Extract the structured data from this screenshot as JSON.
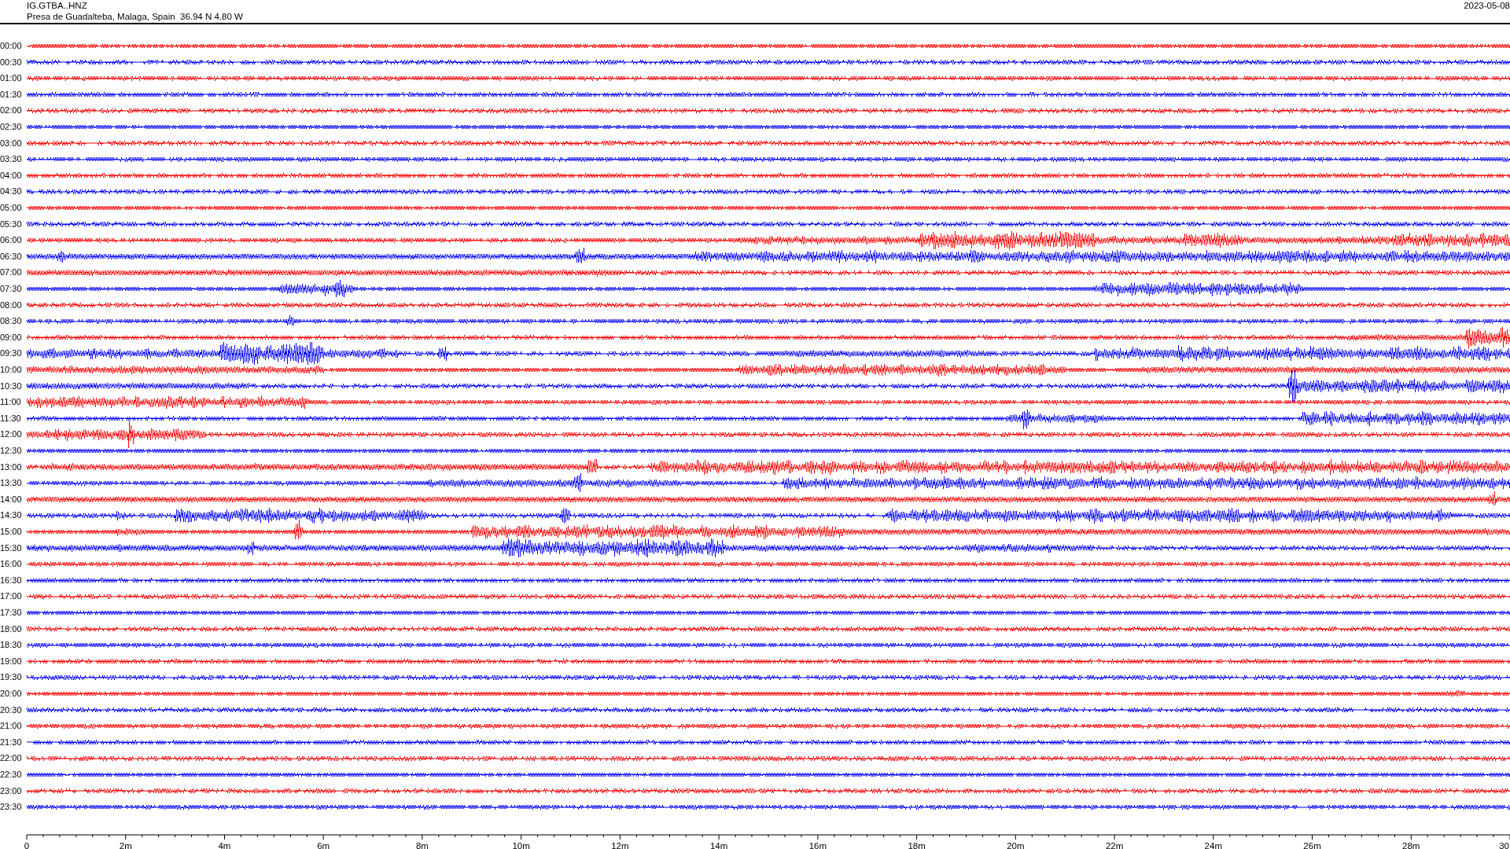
{
  "header": {
    "station": "IG.GTBA..HNZ",
    "location": "Presa de Guadalteba, Malaga, Spain  36.94 N 4.80 W",
    "date": "2023-05-08"
  },
  "rows": [
    {
      "label": "00:00",
      "color": "#ff0000"
    },
    {
      "label": "00:30",
      "color": "#0000ff"
    },
    {
      "label": "01:00",
      "color": "#ff0000"
    },
    {
      "label": "01:30",
      "color": "#0000ff"
    },
    {
      "label": "02:00",
      "color": "#ff0000"
    },
    {
      "label": "02:30",
      "color": "#0000ff"
    },
    {
      "label": "03:00",
      "color": "#ff0000"
    },
    {
      "label": "03:30",
      "color": "#0000ff"
    },
    {
      "label": "04:00",
      "color": "#ff0000"
    },
    {
      "label": "04:30",
      "color": "#0000ff"
    },
    {
      "label": "05:00",
      "color": "#ff0000"
    },
    {
      "label": "05:30",
      "color": "#0000ff"
    },
    {
      "label": "06:00",
      "color": "#ff0000"
    },
    {
      "label": "06:30",
      "color": "#0000ff"
    },
    {
      "label": "07:00",
      "color": "#ff0000"
    },
    {
      "label": "07:30",
      "color": "#0000ff"
    },
    {
      "label": "08:00",
      "color": "#ff0000"
    },
    {
      "label": "08:30",
      "color": "#0000ff"
    },
    {
      "label": "09:00",
      "color": "#ff0000"
    },
    {
      "label": "09:30",
      "color": "#0000ff"
    },
    {
      "label": "10:00",
      "color": "#ff0000"
    },
    {
      "label": "10:30",
      "color": "#0000ff"
    },
    {
      "label": "11:00",
      "color": "#ff0000"
    },
    {
      "label": "11:30",
      "color": "#0000ff"
    },
    {
      "label": "12:00",
      "color": "#ff0000"
    },
    {
      "label": "12:30",
      "color": "#0000ff"
    },
    {
      "label": "13:00",
      "color": "#ff0000"
    },
    {
      "label": "13:30",
      "color": "#0000ff"
    },
    {
      "label": "14:00",
      "color": "#ff0000"
    },
    {
      "label": "14:30",
      "color": "#0000ff"
    },
    {
      "label": "15:00",
      "color": "#ff0000"
    },
    {
      "label": "15:30",
      "color": "#0000ff"
    },
    {
      "label": "16:00",
      "color": "#ff0000"
    },
    {
      "label": "16:30",
      "color": "#0000ff"
    },
    {
      "label": "17:00",
      "color": "#ff0000"
    },
    {
      "label": "17:30",
      "color": "#0000ff"
    },
    {
      "label": "18:00",
      "color": "#ff0000"
    },
    {
      "label": "18:30",
      "color": "#0000ff"
    },
    {
      "label": "19:00",
      "color": "#ff0000"
    },
    {
      "label": "19:30",
      "color": "#0000ff"
    },
    {
      "label": "20:00",
      "color": "#ff0000"
    },
    {
      "label": "20:30",
      "color": "#0000ff"
    },
    {
      "label": "21:00",
      "color": "#ff0000"
    },
    {
      "label": "21:30",
      "color": "#0000ff"
    },
    {
      "label": "22:00",
      "color": "#ff0000"
    },
    {
      "label": "22:30",
      "color": "#0000ff"
    },
    {
      "label": "23:00",
      "color": "#ff0000"
    },
    {
      "label": "23:30",
      "color": "#0000ff"
    }
  ],
  "x_axis": {
    "ticks": [
      "0",
      "2m",
      "4m",
      "6m",
      "8m",
      "10m",
      "12m",
      "14m",
      "16m",
      "18m",
      "20m",
      "22m",
      "24m",
      "26m",
      "28m",
      "30"
    ]
  }
}
